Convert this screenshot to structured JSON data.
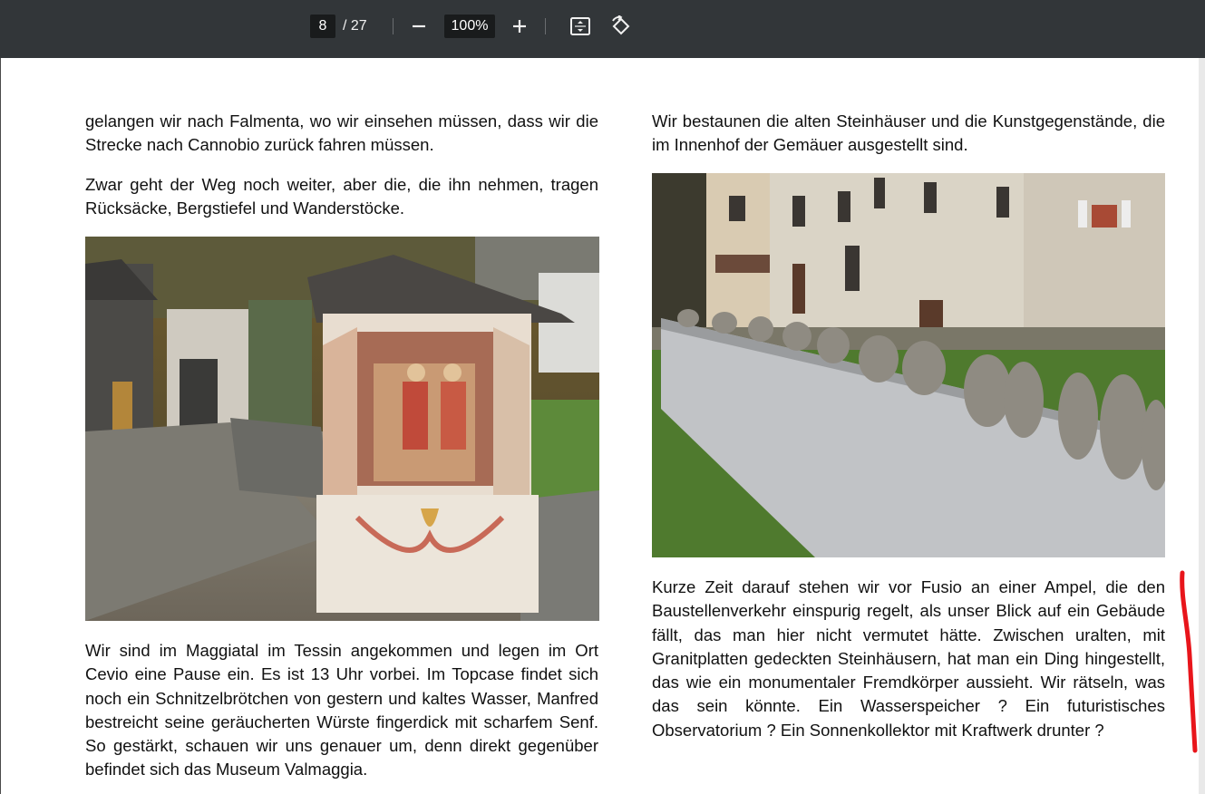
{
  "toolbar": {
    "current_page": "8",
    "page_total": "/ 27",
    "zoom": "100%",
    "icons": [
      "zoom-out-icon",
      "zoom-in-icon",
      "fit-page-icon",
      "rotate-icon"
    ]
  },
  "document": {
    "left_column": {
      "para1": "gelangen wir nach Falmenta, wo wir einsehen müssen, dass wir die Strecke nach Cannobio zurück fahren müssen.",
      "para2": "Zwar geht der Weg noch weiter, aber die, die ihn nehmen, tragen Rücksäcke, Bergstiefel und Wanderstöcke.",
      "para3": "Wir sind im Maggiatal im Tessin angekommen und legen im Ort Cevio eine Pause ein. Es ist 13 Uhr vorbei. Im Topcase findet sich noch ein Schnitzelbrötchen von gestern und kaltes Wasser, Manfred bestreicht seine geräucherten Würste fingerdick mit scharfem Senf.  So gestärkt, schauen wir uns genauer um, denn direkt gegenüber befindet sich das Museum Valmaggia."
    },
    "right_column": {
      "para1": "Wir bestaunen die alten Steinhäuser und die Kunstgegenstände, die im Innenhof der Gemäuer ausgestellt sind.",
      "para2": "Kurze Zeit darauf stehen wir vor Fusio an einer Ampel, die den Baustellenverkehr einspurig regelt, als unser Blick auf ein Gebäude fällt, das man hier nicht vermutet hätte. Zwischen uralten, mit Granitplatten gedeckten Steinhäusern, hat man ein Ding hingestellt, das wie ein monumentaler Fremdkörper aussieht. Wir rätseln, was das sein könnte. Ein Wasserspeicher ? Ein futuristisches Observatorium ? Ein Sonnenkollektor mit Kraftwerk drunter ?"
    }
  },
  "colors": {
    "toolbar_bg": "#323639",
    "annotation": "#e8151b"
  }
}
